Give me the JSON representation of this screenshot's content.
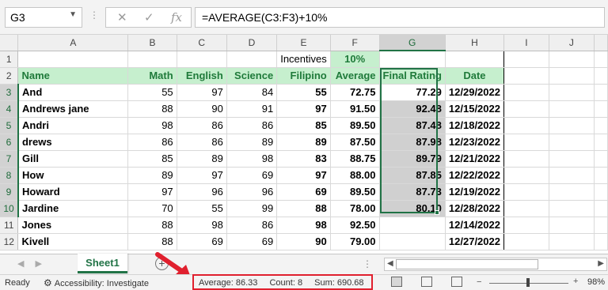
{
  "formula_bar": {
    "name_box": "G3",
    "formula": "=AVERAGE(C3:F3)+10%",
    "cancel_glyph": "✕",
    "enter_glyph": "✓",
    "fx_glyph": "fx",
    "dots": "⋮"
  },
  "columns": [
    "A",
    "B",
    "C",
    "D",
    "E",
    "F",
    "G",
    "H",
    "I",
    "J"
  ],
  "row1": {
    "row": "1",
    "incentives_label": "Incentives",
    "incentives_value": "10%"
  },
  "header_row": {
    "row": "2",
    "name": "Name",
    "math": "Math",
    "english": "English",
    "science": "Science",
    "filipino": "Filipino",
    "average": "Average",
    "final_rating": "Final Rating",
    "date": "Date"
  },
  "rows": [
    {
      "row": "3",
      "name": "And",
      "math": "55",
      "english": "97",
      "science": "84",
      "filipino": "55",
      "average": "72.75",
      "final": "77.29",
      "date": "12/29/2022"
    },
    {
      "row": "4",
      "name": "Andrews jane",
      "math": "88",
      "english": "90",
      "science": "91",
      "filipino": "97",
      "average": "91.50",
      "final": "92.48",
      "date": "12/15/2022"
    },
    {
      "row": "5",
      "name": "Andri",
      "math": "98",
      "english": "86",
      "science": "86",
      "filipino": "85",
      "average": "89.50",
      "final": "87.48",
      "date": "12/18/2022"
    },
    {
      "row": "6",
      "name": "drews",
      "math": "86",
      "english": "86",
      "science": "89",
      "filipino": "89",
      "average": "87.50",
      "final": "87.98",
      "date": "12/23/2022"
    },
    {
      "row": "7",
      "name": "Gill",
      "math": "85",
      "english": "89",
      "science": "98",
      "filipino": "83",
      "average": "88.75",
      "final": "89.79",
      "date": "12/21/2022"
    },
    {
      "row": "8",
      "name": "How",
      "math": "89",
      "english": "97",
      "science": "69",
      "filipino": "97",
      "average": "88.00",
      "final": "87.85",
      "date": "12/22/2022"
    },
    {
      "row": "9",
      "name": "Howard",
      "math": "97",
      "english": "96",
      "science": "96",
      "filipino": "69",
      "average": "89.50",
      "final": "87.73",
      "date": "12/19/2022"
    },
    {
      "row": "10",
      "name": "Jardine",
      "math": "70",
      "english": "55",
      "science": "99",
      "filipino": "88",
      "average": "78.00",
      "final": "80.10",
      "date": "12/28/2022"
    },
    {
      "row": "11",
      "name": "Jones",
      "math": "88",
      "english": "98",
      "science": "86",
      "filipino": "98",
      "average": "92.50",
      "final": "",
      "date": "12/14/2022"
    },
    {
      "row": "12",
      "name": "Kivell",
      "math": "88",
      "english": "69",
      "science": "69",
      "filipino": "90",
      "average": "79.00",
      "final": "",
      "date": "12/27/2022"
    }
  ],
  "sheet_tabs": {
    "active": "Sheet1",
    "add_glyph": "+",
    "nav_prev": "◀",
    "nav_next": "▶",
    "dots": "⋮"
  },
  "status_bar": {
    "ready": "Ready",
    "accessibility": "Accessibility: Investigate",
    "average": "Average: 86.33",
    "count": "Count: 8",
    "sum": "Sum: 690.68",
    "zoom_minus": "−",
    "zoom_plus": "+",
    "zoom": "98%"
  },
  "colors": {
    "accent_green": "#217346",
    "header_fill": "#c6efce",
    "highlight_red": "#e0202e",
    "selection_fill": "#d0d0d0"
  }
}
